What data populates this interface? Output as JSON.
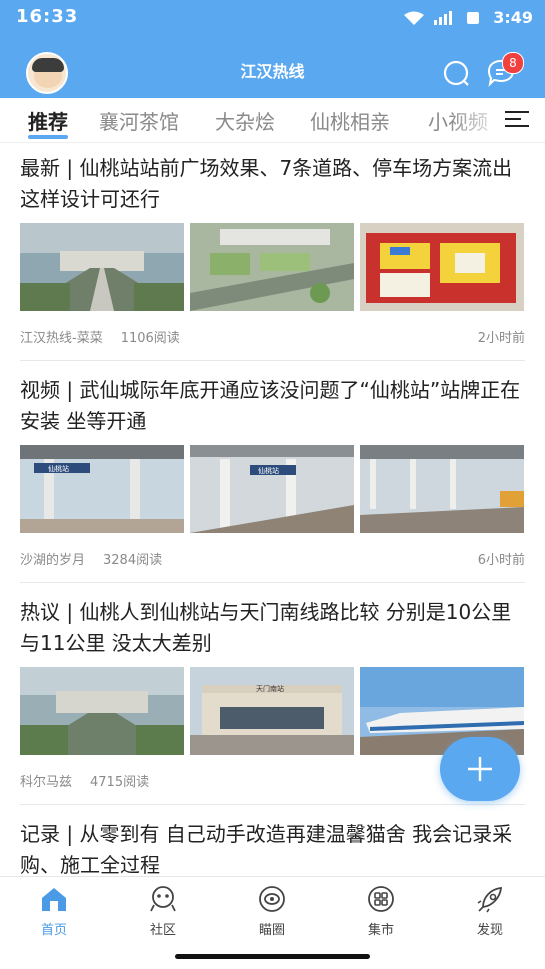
{
  "status_bar": {
    "time_left": "16:33",
    "time_right": "3:49"
  },
  "header": {
    "title": "江汉热线",
    "badge_count": "8"
  },
  "tabs": [
    {
      "label": "推荐",
      "active": true
    },
    {
      "label": "襄河茶馆"
    },
    {
      "label": "大杂烩"
    },
    {
      "label": "仙桃相亲"
    },
    {
      "label": "小视频"
    }
  ],
  "articles": [
    {
      "title": "最新 | 仙桃站站前广场效果、7条道路、停车场方案流出 这样设计可还行",
      "author": "江汉热线-菜菜",
      "reads": "1106阅读",
      "time": "2小时前"
    },
    {
      "title": "视频 | 武仙城际年底开通应该没问题了“仙桃站”站牌正在安装 坐等开通",
      "author": "沙湖的岁月",
      "reads": "3284阅读",
      "time": "6小时前"
    },
    {
      "title": "热议 | 仙桃人到仙桃站与天门南线路比较 分别是10公里与11公里 没太大差别",
      "author": "科尔马兹",
      "reads": "4715阅读",
      "time": ""
    },
    {
      "title": "记录 | 从零到有 自己动手改造再建温馨猫舍 我会记录采购、施工全过程",
      "author": "",
      "reads": "",
      "time": ""
    }
  ],
  "image_labels": {
    "station_sign_1": "仙桃站",
    "station_sign_2": "仙桃站",
    "tianmen_sign": "天门南站"
  },
  "bottom_nav": [
    {
      "label": "首页",
      "icon": "home-icon",
      "active": true
    },
    {
      "label": "社区",
      "icon": "community-icon"
    },
    {
      "label": "瞄圈",
      "icon": "eye-icon"
    },
    {
      "label": "集市",
      "icon": "market-icon"
    },
    {
      "label": "发现",
      "icon": "rocket-icon"
    }
  ],
  "colors": {
    "brand": "#5aa8f0",
    "badge": "#f0413e"
  }
}
